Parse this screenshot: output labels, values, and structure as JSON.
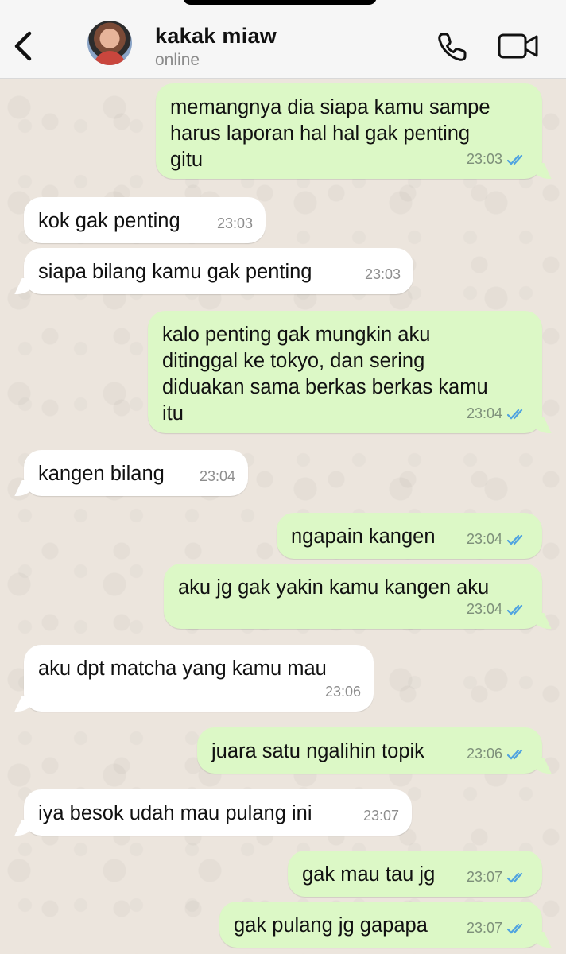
{
  "header": {
    "contact_name": "kakak miaw",
    "status": "online",
    "back_icon": "chevron-left-icon",
    "call_icon": "phone-icon",
    "video_icon": "video-camera-icon"
  },
  "colors": {
    "outgoing_bubble": "#dcf8c6",
    "incoming_bubble": "#ffffff",
    "read_ticks": "#4fa3e0",
    "chat_background": "#ece5dd"
  },
  "messages": [
    {
      "direction": "out",
      "text": "memangnya dia siapa kamu sampe\nharus laporan hal hal gak penting\ngitu",
      "time": "23:03",
      "status": "read"
    },
    {
      "direction": "in",
      "text": "kok gak penting",
      "time": "23:03"
    },
    {
      "direction": "in",
      "text": "siapa bilang kamu gak penting",
      "time": "23:03"
    },
    {
      "direction": "out",
      "text": "kalo penting gak mungkin aku\nditinggal ke tokyo, dan sering\ndiduakan sama berkas berkas kamu\nitu",
      "time": "23:04",
      "status": "read"
    },
    {
      "direction": "in",
      "text": "kangen bilang",
      "time": "23:04"
    },
    {
      "direction": "out",
      "text": "ngapain kangen",
      "time": "23:04",
      "status": "read"
    },
    {
      "direction": "out",
      "text": "aku jg gak yakin kamu kangen aku",
      "time": "23:04",
      "status": "read"
    },
    {
      "direction": "in",
      "text": "aku dpt matcha yang kamu mau",
      "time": "23:06"
    },
    {
      "direction": "out",
      "text": "juara satu ngalihin topik",
      "time": "23:06",
      "status": "read"
    },
    {
      "direction": "in",
      "text": "iya besok udah mau pulang ini",
      "time": "23:07"
    },
    {
      "direction": "out",
      "text": "gak mau tau jg",
      "time": "23:07",
      "status": "read"
    },
    {
      "direction": "out",
      "text": "gak pulang jg gapapa",
      "time": "23:07",
      "status": "read"
    }
  ]
}
